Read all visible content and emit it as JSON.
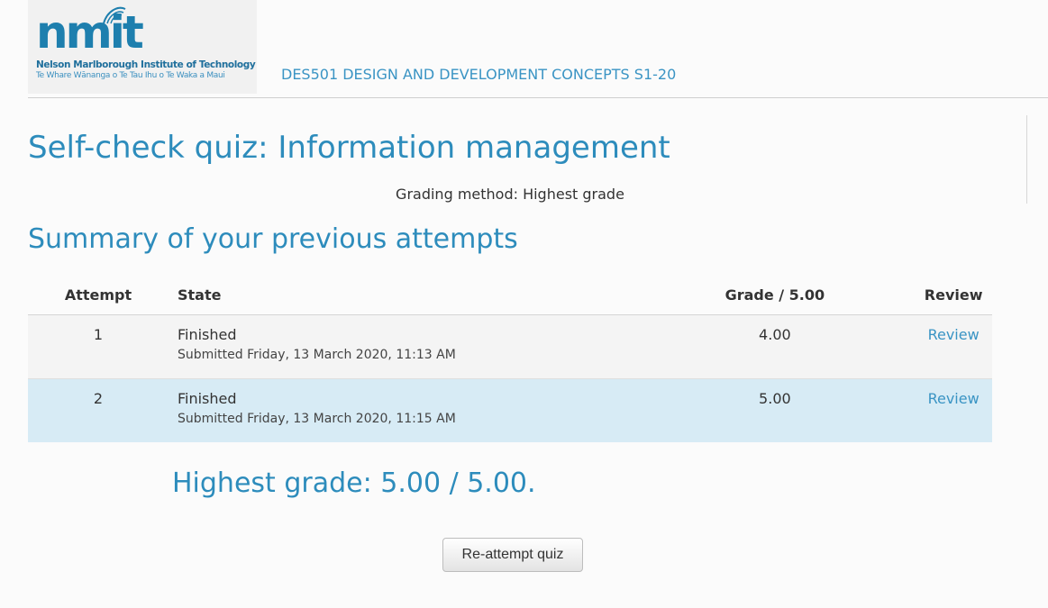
{
  "header": {
    "logo": {
      "word": "nmit",
      "line1": "Nelson Marlborough Institute of Technology",
      "line2": "Te Whare Wānanga o Te Tau Ihu o Te Waka a Maui"
    },
    "course_link": "DES501 DESIGN AND DEVELOPMENT CONCEPTS S1-20"
  },
  "main": {
    "title": "Self-check quiz: Information management",
    "grading_method": "Grading method: Highest grade",
    "summary_title": "Summary of your previous attempts",
    "table": {
      "headers": {
        "attempt": "Attempt",
        "state": "State",
        "grade": "Grade / 5.00",
        "review": "Review"
      },
      "rows": [
        {
          "attempt": "1",
          "state": "Finished",
          "submitted": "Submitted Friday, 13 March 2020, 11:13 AM",
          "grade": "4.00",
          "review": "Review"
        },
        {
          "attempt": "2",
          "state": "Finished",
          "submitted": "Submitted Friday, 13 March 2020, 11:15 AM",
          "grade": "5.00",
          "review": "Review"
        }
      ]
    },
    "highest_grade": "Highest grade: 5.00 / 5.00.",
    "reattempt_label": "Re-attempt quiz"
  },
  "colors": {
    "accent": "#2d8cbc",
    "link": "#3a94c4",
    "selected_row": "#d7ebf5",
    "logo": "#1e7fae"
  }
}
